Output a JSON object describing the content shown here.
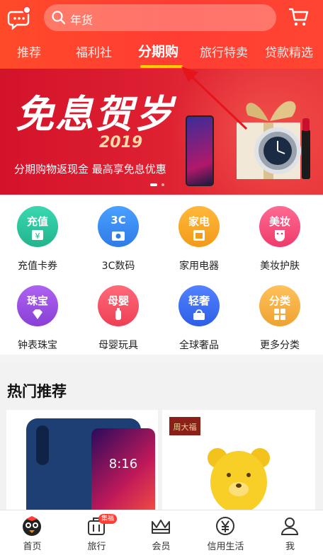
{
  "header": {
    "search_value": "年货",
    "tabs": [
      {
        "label": "推荐"
      },
      {
        "label": "福利社"
      },
      {
        "label": "分期购"
      },
      {
        "label": "旅行特卖"
      },
      {
        "label": "贷款精选"
      }
    ],
    "active_tab": "分期购",
    "colors": {
      "primary": "#ff3d33",
      "tab_indicator": "#ffcc00"
    }
  },
  "banner": {
    "title": "免息贺岁",
    "year": "2019",
    "subtitle": "分期购物返现金   最高享免息优惠"
  },
  "categories": [
    {
      "label": "充值卡券",
      "icon_text": "充值",
      "icon": "recharge-icon",
      "color": "#2fc9a4"
    },
    {
      "label": "3C数码",
      "icon_text": "3C",
      "icon": "camera-icon",
      "color": "#3d8ef5"
    },
    {
      "label": "家用电器",
      "icon_text": "家电",
      "icon": "appliance-icon",
      "color": "#f6a623"
    },
    {
      "label": "美妆护肤",
      "icon_text": "美妆",
      "icon": "mask-icon",
      "color": "#f24d7d"
    },
    {
      "label": "钟表珠宝",
      "icon_text": "珠宝",
      "icon": "gem-icon",
      "color": "#9a4fe0"
    },
    {
      "label": "母婴玩具",
      "icon_text": "母婴",
      "icon": "baby-bottle-icon",
      "color": "#f5566a"
    },
    {
      "label": "全球奢品",
      "icon_text": "轻奢",
      "icon": "bag-icon",
      "color": "#3f6bf0"
    },
    {
      "label": "更多分类",
      "icon_text": "分类",
      "icon": "grid-icon",
      "color": "#f2b041"
    }
  ],
  "hot": {
    "title": "热门推荐",
    "products": [
      {
        "screen_time": "8:16"
      },
      {
        "brand": "周大福"
      }
    ]
  },
  "bottom_nav": [
    {
      "label": "首页",
      "icon": "home-mascot-icon"
    },
    {
      "label": "旅行",
      "icon": "suitcase-icon",
      "badge": "集福"
    },
    {
      "label": "会员",
      "icon": "crown-icon"
    },
    {
      "label": "信用生活",
      "icon": "yen-icon"
    },
    {
      "label": "我",
      "icon": "user-icon"
    }
  ]
}
